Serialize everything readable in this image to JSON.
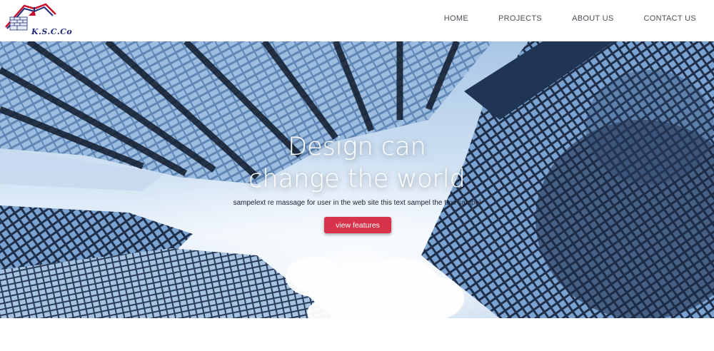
{
  "brand": {
    "name": "K.S.C.Co",
    "colors": {
      "navy": "#1e2a78",
      "red": "#c8102e"
    }
  },
  "nav": {
    "items": [
      {
        "label": "HOME"
      },
      {
        "label": "PROJECTS"
      },
      {
        "label": "ABOUT US"
      },
      {
        "label": "CONTACT US"
      }
    ]
  },
  "hero": {
    "title_line1": "Design can",
    "title_line2": "change the world",
    "subtitle": "sampelext re massage for user in the web site this text sampel the text sampel",
    "button_label": "view features",
    "button_color": "#d8334a"
  }
}
